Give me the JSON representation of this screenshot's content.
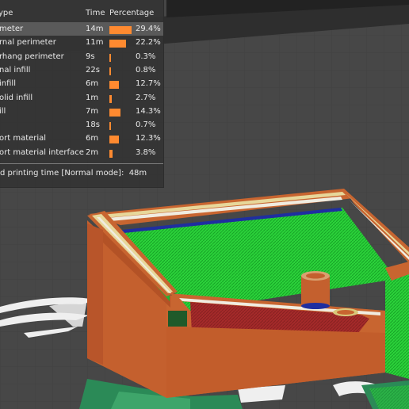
{
  "stats": {
    "header": {
      "type": "ype",
      "time": "Time",
      "percentage": "Percentage"
    },
    "rows": [
      {
        "type": "meter",
        "time": "14m",
        "pct": "29.4%",
        "value": 29.4,
        "highlight": true
      },
      {
        "type": "rnal perimeter",
        "time": "11m",
        "pct": "22.2%",
        "value": 22.2
      },
      {
        "type": "rhang perimeter",
        "time": "9s",
        "pct": "0.3%",
        "value": 0.3
      },
      {
        "type": "nal infill",
        "time": "22s",
        "pct": "0.8%",
        "value": 0.8
      },
      {
        "type": "infill",
        "time": "6m",
        "pct": "12.7%",
        "value": 12.7
      },
      {
        "type": "olid infill",
        "time": "1m",
        "pct": "2.7%",
        "value": 2.7
      },
      {
        "type": "ill",
        "time": "7m",
        "pct": "14.3%",
        "value": 14.3
      },
      {
        "type": "",
        "time": "18s",
        "pct": "0.7%",
        "value": 0.7
      },
      {
        "type": "ort material",
        "time": "6m",
        "pct": "12.3%",
        "value": 12.3
      },
      {
        "type": "ort material interface",
        "time": "2m",
        "pct": "3.8%",
        "value": 3.8
      }
    ],
    "total_label": "d printing time [Normal mode]:",
    "total_value": "48m"
  },
  "colors": {
    "background": "#464646",
    "perimeter": "#c4602e",
    "infill": "#22c531",
    "solid_infill": "#a52a2a",
    "support": "#2b8a57",
    "bridge": "#1f2ea0",
    "skirt": "#d9c87a",
    "bar": "#ff8a30"
  }
}
